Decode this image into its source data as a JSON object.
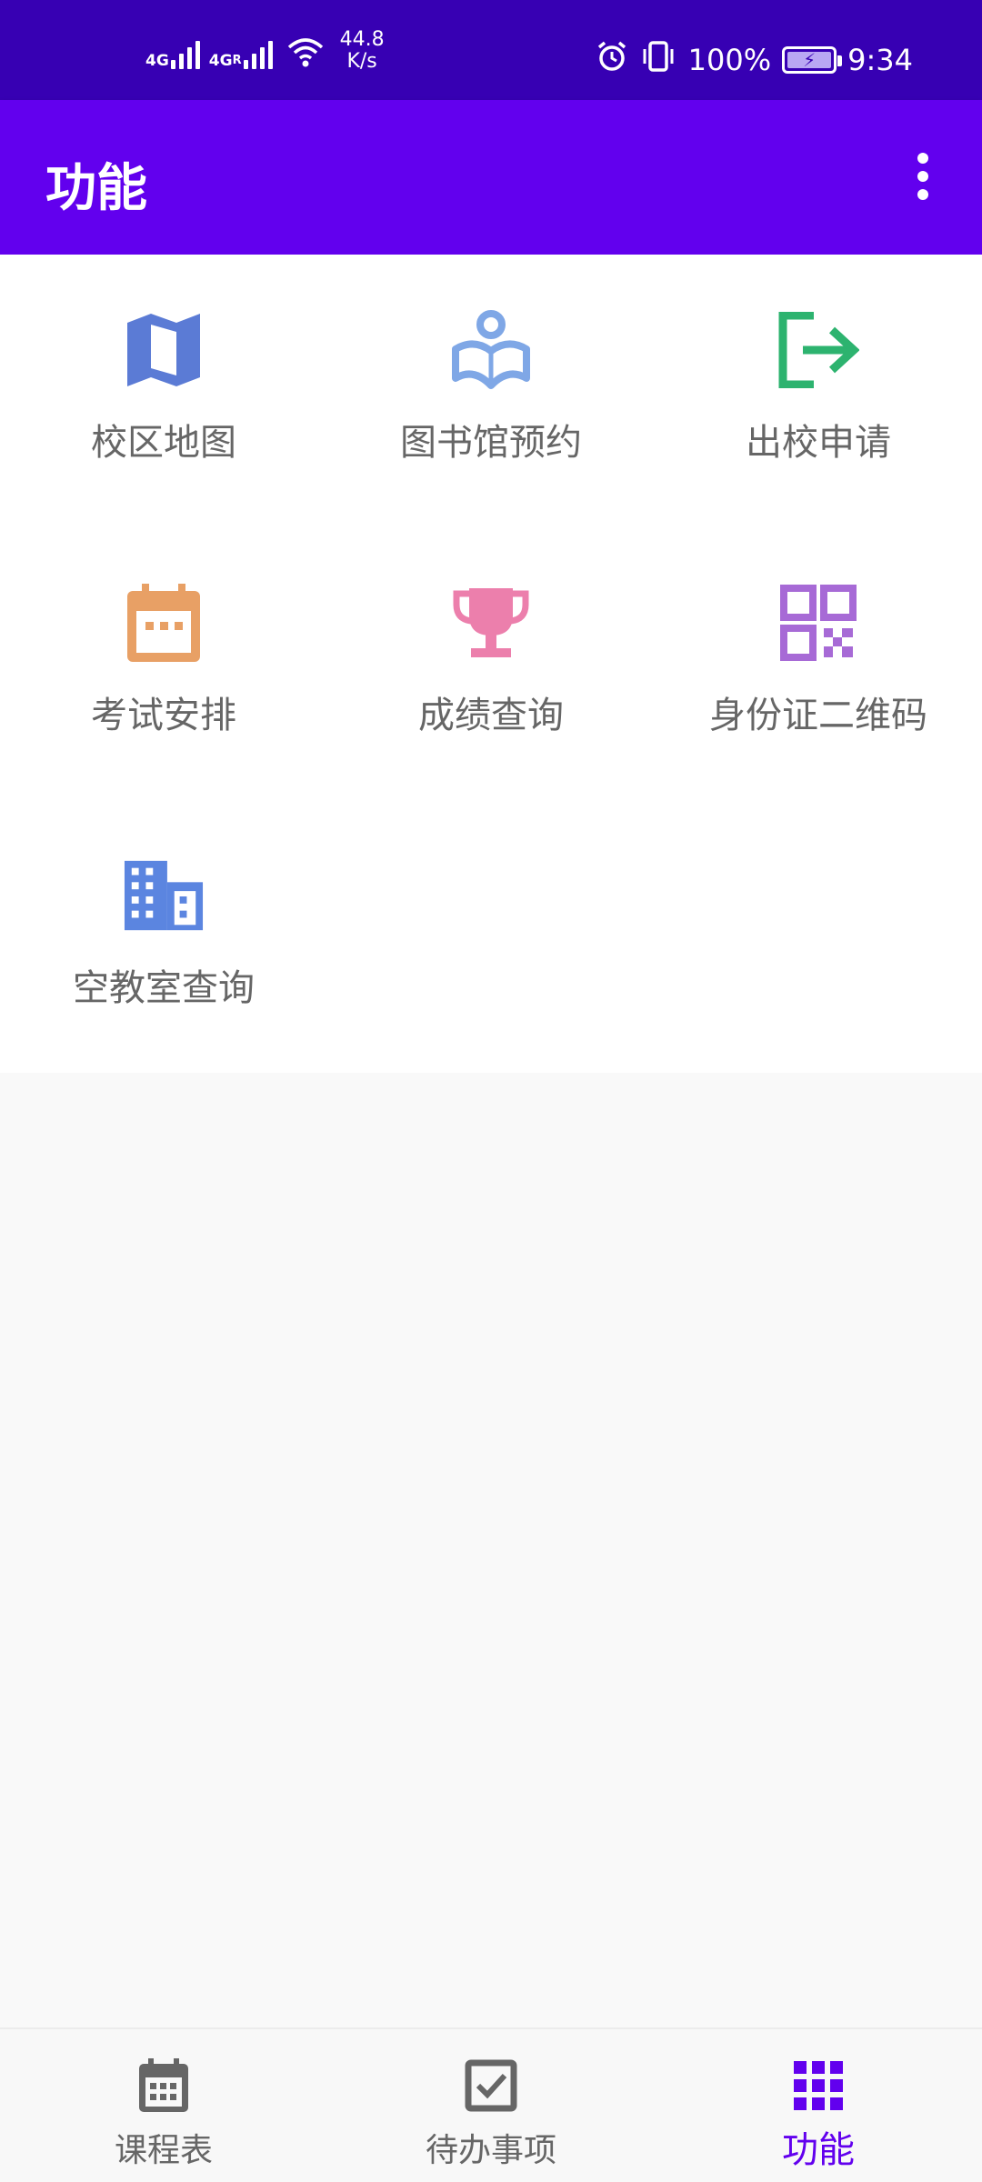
{
  "status_bar": {
    "net1": "4G",
    "net2": "4G",
    "net2_sup": "R",
    "speed_value": "44.8",
    "speed_unit": "K/s",
    "battery_percent": "100%",
    "time": "9:34"
  },
  "app_bar": {
    "title": "功能",
    "overflow_icon": "more-vert-icon"
  },
  "functions": [
    {
      "label": "校区地图",
      "icon": "map-icon",
      "color": "#5b7bd5"
    },
    {
      "label": "图书馆预约",
      "icon": "library-reader-icon",
      "color": "#7fa7e6"
    },
    {
      "label": "出校申请",
      "icon": "exit-icon",
      "color": "#2db36f"
    },
    {
      "label": "考试安排",
      "icon": "calendar-icon",
      "color": "#e8a065"
    },
    {
      "label": "成绩查询",
      "icon": "trophy-icon",
      "color": "#ec7fac"
    },
    {
      "label": "身份证二维码",
      "icon": "qr-code-icon",
      "color": "#a76ad6"
    },
    {
      "label": "空教室查询",
      "icon": "building-icon",
      "color": "#5b85e0"
    }
  ],
  "bottom_nav": {
    "items": [
      {
        "label": "课程表",
        "icon": "calendar-icon",
        "active": false
      },
      {
        "label": "待办事项",
        "icon": "checkbox-icon",
        "active": false
      },
      {
        "label": "功能",
        "icon": "apps-grid-icon",
        "active": true
      }
    ],
    "active_color": "#6200ee",
    "inactive_color": "#666666"
  },
  "colors": {
    "status_bar": "#3700b3",
    "app_bar": "#6200ee"
  }
}
